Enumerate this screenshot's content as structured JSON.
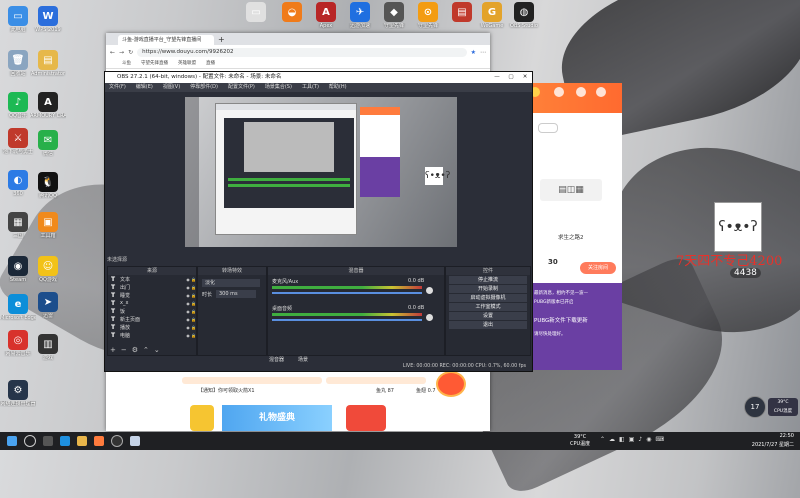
{
  "desktop": {
    "icons_left": [
      {
        "label": "此电脑",
        "color": "#3a8ee6",
        "glyph": "▭"
      },
      {
        "label": "回收站",
        "color": "#8aa5c0",
        "glyph": "🗑"
      },
      {
        "label": "QQ音乐",
        "color": "#1db954",
        "glyph": "♪"
      },
      {
        "label": "地下城与勇士",
        "color": "#c0392b",
        "glyph": "⚔"
      },
      {
        "label": "360",
        "color": "#2c7be5",
        "glyph": "◐"
      },
      {
        "label": "三国",
        "color": "#444",
        "glyph": "▦"
      },
      {
        "label": "Steam",
        "color": "#1b2838",
        "glyph": "◉"
      },
      {
        "label": "Microsoft Edge",
        "color": "#0c8ed9",
        "glyph": "e"
      },
      {
        "label": "网易云音乐",
        "color": "#d8322c",
        "glyph": "◎"
      },
      {
        "label": "网络连接管理器",
        "color": "#26354a",
        "glyph": "⚙"
      }
    ],
    "icons_second": [
      {
        "label": "WPS 2019",
        "color": "#2b6edc",
        "glyph": "W"
      },
      {
        "label": "Administrator",
        "color": "#e6b84a",
        "glyph": "▤"
      },
      {
        "label": "ARMOURY CRATE",
        "color": "#222",
        "glyph": "A"
      },
      {
        "label": "微信",
        "color": "#28b04a",
        "glyph": "✉"
      },
      {
        "label": "腾讯QQ",
        "color": "#111",
        "glyph": "🐧"
      },
      {
        "label": "工具箱",
        "color": "#f08a1c",
        "glyph": "▣"
      },
      {
        "label": "QQ游戏",
        "color": "#f2c218",
        "glyph": "☺"
      },
      {
        "label": "迅雷",
        "color": "#1c4e8c",
        "glyph": "➤"
      },
      {
        "label": "游戏",
        "color": "#333",
        "glyph": "▥"
      }
    ],
    "icons_top": [
      {
        "label": "",
        "color": "#e0e0e0",
        "glyph": "▭"
      },
      {
        "label": "",
        "color": "#f07b1a",
        "glyph": "◒"
      },
      {
        "label": "Apex",
        "color": "#b82626",
        "glyph": "A"
      },
      {
        "label": "迅游加速",
        "color": "#1f6fe0",
        "glyph": "✈"
      },
      {
        "label": "守望先锋",
        "color": "#555",
        "glyph": "◆"
      },
      {
        "label": "守望先锋",
        "color": "#f39c12",
        "glyph": "⊙"
      },
      {
        "label": "",
        "color": "#c0392b",
        "glyph": "▤"
      },
      {
        "label": "WeGame",
        "color": "#e3a32a",
        "glyph": "G"
      },
      {
        "label": "OBS Studio",
        "color": "#222",
        "glyph": "◍"
      }
    ],
    "overlay_text": "7天四不专己4200",
    "overlay_sub": "4438",
    "weather_widget": {
      "value": "17",
      "unit": "39°C",
      "sub": "CPU温度"
    }
  },
  "browser": {
    "tab_title": "斗鱼-游戏直播平台_守望先锋直播间",
    "new_tab": "+",
    "url": "https://www.douyu.com/9926202",
    "bookmarks": [
      "斗鱼",
      "守望先锋直播",
      "英雄联盟",
      "直播"
    ],
    "bottom_items": [
      "【通知】你可领取火箭X1",
      "鱼丸 87",
      "鱼翅 0.7"
    ],
    "promo_text": "礼物盛典"
  },
  "obs": {
    "title": "OBS 27.2.1 (64-bit, windows) - 配置文件: 未命名 - 场景: 未命名",
    "menu": [
      "文件(F)",
      "编辑(E)",
      "视图(V)",
      "停靠部件(D)",
      "配置文件(P)",
      "场景集合(S)",
      "工具(T)",
      "帮助(H)"
    ],
    "docks": {
      "scenes": "场景",
      "sources": "来源",
      "transitions": "转场特效",
      "mixer": "混音器",
      "controls": "控件"
    },
    "no_scene": "未选择源",
    "sources": [
      {
        "type": "T",
        "name": "文本"
      },
      {
        "type": "T",
        "name": "出门"
      },
      {
        "type": "T",
        "name": "睡觉"
      },
      {
        "type": "T",
        "name": "x_x"
      },
      {
        "type": "T",
        "name": "饭"
      },
      {
        "type": "T",
        "name": "新主页面"
      },
      {
        "type": "T",
        "name": "播放"
      },
      {
        "type": "T",
        "name": "电脑"
      }
    ],
    "transition": {
      "mode": "淡化",
      "duration_label": "时长",
      "duration": "300 ms"
    },
    "mixer": [
      {
        "name": "麦克风/Aux",
        "level": "0.0 dB"
      },
      {
        "name": "桌面音频",
        "level": "0.0 dB"
      }
    ],
    "controls": [
      "停止推流",
      "开始录制",
      "启动虚拟摄像机",
      "工作室模式",
      "设置",
      "退出"
    ],
    "bottom_tabs": [
      "混音器",
      "场景"
    ],
    "status": "LIVE: 00:00:00   REC: 00:00:00   CPU: 0.7%, 60.00 fps"
  },
  "douyu": {
    "room_name": "求生之路2",
    "viewers": "30",
    "follow_label": "关注房间",
    "notice_lines": [
      "最新消息，相约不见一波—",
      "PUBG新版本已开启",
      "PUBG新文件下载更新",
      "请尽快处理好。"
    ]
  },
  "taskbar": {
    "temp": "39°C",
    "temp_label": "CPU温度",
    "time": "22:50",
    "date": "2021/7/27 星期二"
  }
}
